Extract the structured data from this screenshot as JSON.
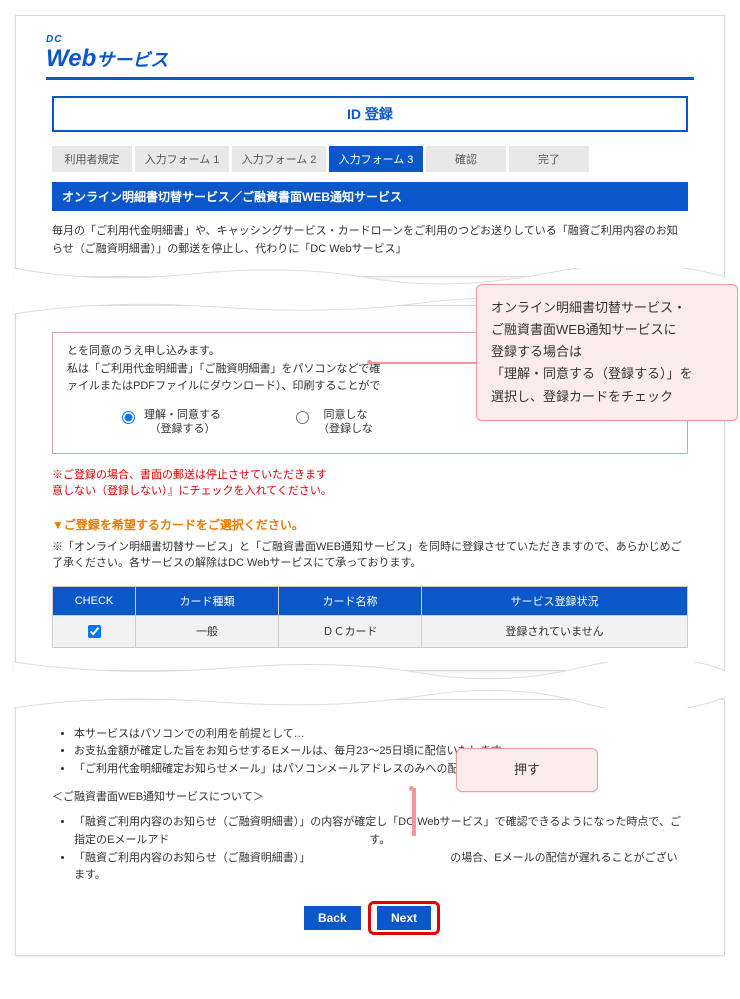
{
  "logo": {
    "dc": "DC",
    "web": "Web",
    "svc": "サービス"
  },
  "title": "ID 登録",
  "steps": [
    "利用者規定",
    "入力フォーム 1",
    "入力フォーム 2",
    "入力フォーム 3",
    "確認",
    "完了"
  ],
  "active_step": 3,
  "section_head": "オンライン明細書切替サービス／ご融資書面WEB通知サービス",
  "intro": "毎月の「ご利用代金明細書」や、キャッシングサービス・カードローンをご利用のつどお送りしている「融資ご利用内容のお知らせ（ご融資明細書）」の郵送を停止し、代わりに「DC Webサービス」",
  "consent": {
    "line1": "とを同意のうえ申し込みます。",
    "line2": "私は「ご利用代金明細書」「ご融資明細書」をパソコンなどで確",
    "line3": "ァイルまたはPDFファイルにダウンロード）、印刷することがで",
    "radio_agree": {
      "top": "理解・同意する",
      "bottom": "（登録する）"
    },
    "radio_disagree": {
      "top": "同意しな",
      "bottom": "（登録しな"
    }
  },
  "red_note": "※ご登録の場合、書面の郵送は停止させていただきます\n意しない（登録しない）』にチェックを入れてください。",
  "orange_head": "▼ご登録を希望するカードをご選択ください。",
  "note2": "※「オンライン明細書切替サービス」と「ご融資書面WEB通知サービス」を同時に登録させていただきますので、あらかじめご了承ください。各サービスの解除はDC Webサービスにて承っております。",
  "table": {
    "headers": [
      "CHECK",
      "カード種類",
      "カード名称",
      "サービス登録状況"
    ],
    "row": [
      "",
      "一般",
      "ＤＣカード",
      "登録されていません"
    ]
  },
  "card3": {
    "b1": "本サービスはパソコンでの利用を前提として…",
    "b2": "お支払金額が確定した旨をお知らせするEメールは、毎月23〜25日頃に配信いたします。",
    "b3": "「ご利用代金明細確定お知らせメール」はパソコンメールアドレスのみへの配信となります。",
    "sub": "＜ご融資書面WEB通知サービスについて＞",
    "b4": "「融資ご利用内容のお知らせ（ご融資明細書）」の内容が確定し「DC Webサービス」で確認できるようになった時点で、ご指定のEメールアド",
    "b4b": "す。",
    "b5": "「融資ご利用内容のお知らせ（ご融資明細書）」",
    "b5b": "の場合、Eメールの配信が遅れることがございます。"
  },
  "buttons": {
    "back": "Back",
    "next": "Next"
  },
  "annot1_lines": [
    "オンライン明細書切替サービス・",
    "ご融資書面WEB通知サービスに",
    "登録する場合は",
    "「理解・同意する（登録する）」を",
    "選択し、登録カードをチェック"
  ],
  "annot2": "押す"
}
